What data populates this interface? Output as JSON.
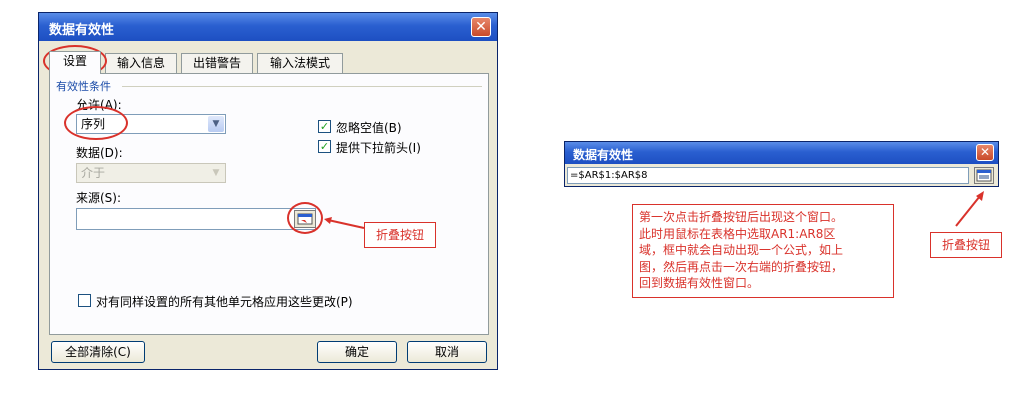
{
  "dialog1": {
    "title": "数据有效性",
    "close_glyph": "✕",
    "tabs": [
      {
        "label": "设置"
      },
      {
        "label": "输入信息"
      },
      {
        "label": "出错警告"
      },
      {
        "label": "输入法模式"
      }
    ],
    "group_title": "有效性条件",
    "allow_label": "允许(A):",
    "allow_value": "序列",
    "data_label": "数据(D):",
    "data_value": "介于",
    "ignore_blank_label": "忽略空值(B)",
    "dropdown_arrow_label": "提供下拉箭头(I)",
    "check_glyph": "✓",
    "source_label": "来源(S):",
    "source_value": "",
    "apply_all_label": "对有同样设置的所有其他单元格应用这些更改(P)",
    "clear_all_button": "全部清除(C)",
    "ok_button": "确定",
    "cancel_button": "取消",
    "dropdown_glyph": "▼",
    "annotation_label": "折叠按钮"
  },
  "dialog2": {
    "title": "数据有效性",
    "close_glyph": "✕",
    "ref_value": "=$AR$1:$AR$8",
    "annotation_label": "折叠按钮",
    "instruction_lines": [
      "第一次点击折叠按钮后出现这个窗口。",
      "此时用鼠标在表格中选取AR1:AR8区",
      "域，框中就会自动出现一个公式，如上",
      "图，然后再点击一次右端的折叠按钮，",
      "回到数据有效性窗口。"
    ]
  },
  "colors": {
    "titlebar": "#2a5fd0",
    "annotation_red": "#d9322b",
    "dialog_bg": "#ece9d8"
  }
}
